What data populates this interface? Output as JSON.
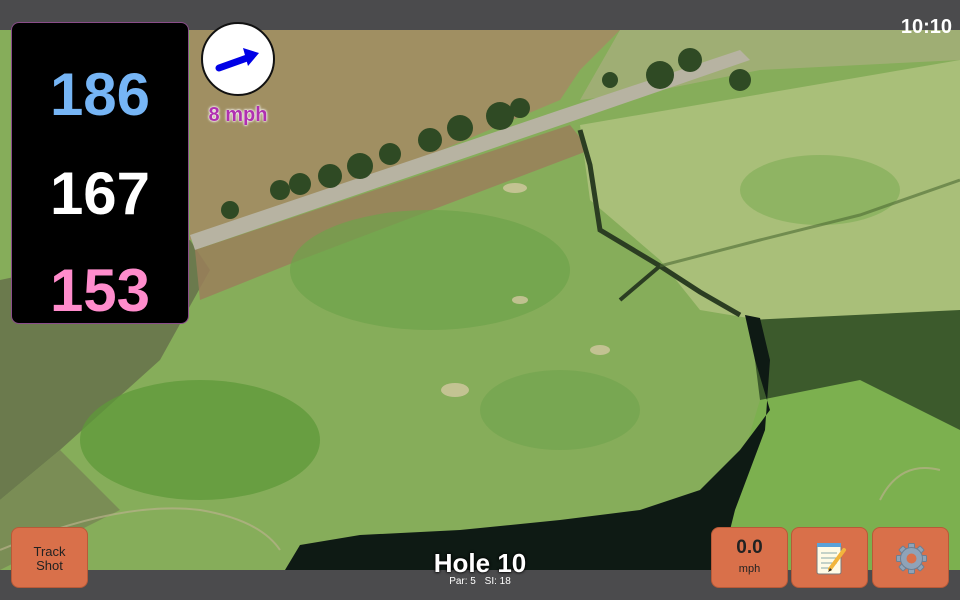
{
  "status_bar": {
    "clock": "10:10"
  },
  "yardages": {
    "back": "186",
    "center": "167",
    "front": "153"
  },
  "wind": {
    "speed": "8 mph",
    "direction_icon": "arrow-icon"
  },
  "hole": {
    "title": "Hole 10",
    "par": "Par: 5",
    "stroke_index": "SI: 18"
  },
  "buttons": {
    "track_shot_line1": "Track",
    "track_shot_line2": "Shot",
    "speed_value": "0.0",
    "speed_unit": "mph",
    "notes_icon": "notepad-icon",
    "settings_icon": "gear-icon"
  },
  "colors": {
    "back_yardage": "#76b5f5",
    "center_yardage": "#ffffff",
    "front_yardage": "#ff8ccc",
    "wind_text": "#b030b0",
    "button": "#d9704a"
  }
}
